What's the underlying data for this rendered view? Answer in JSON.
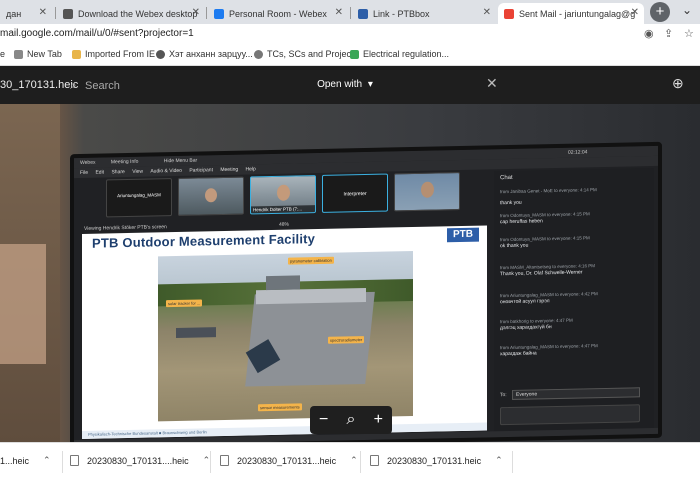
{
  "browser": {
    "tabs": [
      {
        "label": "дан",
        "color": "#888"
      },
      {
        "label": "Download the Webex desktop",
        "color": "#555"
      },
      {
        "label": "Personal Room - Webex",
        "color": "#1d7bf0"
      },
      {
        "label": "Link - PTBbox",
        "color": "#2d5ea8"
      },
      {
        "label": "Sent Mail - jariuntungalag@g",
        "color": "#ea4335"
      }
    ],
    "add_tab": "+",
    "url": "mail.google.com/mail/u/0/#sent?projector=1",
    "bookmarks": [
      "e",
      "New Tab",
      "Imported From IE",
      "Хэт анханн зарцуу...",
      "TCs, SCs and Projec...",
      "Electrical regulation..."
    ]
  },
  "viewer": {
    "file_name": "30_170131.heic",
    "search_placeholder": "Search",
    "open_with": "Open with"
  },
  "webex": {
    "title_items": [
      "Webex",
      "Meeting Info",
      "Hide Menu Bar"
    ],
    "time": "02:12:04",
    "menu": [
      "File",
      "Edit",
      "Share",
      "View",
      "Audio & Video",
      "Participant",
      "Meeting",
      "Help"
    ],
    "participants": [
      "Ariuntungalag_MASM",
      "",
      "Hendrik Dolter PTB (7:...",
      "Interpreter",
      ""
    ],
    "viewing_label": "Viewing Hendrik Stöker PTB's screen",
    "zoom": "48%",
    "slide": {
      "title": "PTB Outdoor Measurement Facility",
      "logo": "PTB",
      "callouts": [
        "pyranometer calibration",
        "solar tracker for ...",
        "sensor measurements",
        "spectroradiometer"
      ],
      "footer": "Physikalisch-Technische Bundesanstalt  ■  Braunschweig und Berlin"
    },
    "chat": {
      "header": "Chat",
      "messages": [
        {
          "from": "",
          "text": "thank you"
        },
        {
          "from": "from Janibaa Genet - MoE to everyone:  4:14 PM",
          "text": ""
        },
        {
          "from": "from Odontuya_MASM to everyone:  4:15 PM",
          "text": "сар heruffas heben"
        },
        {
          "from": "from Odontuya_MASM to everyone:  4:15 PM",
          "text": "ok thank you"
        },
        {
          "from": "from MASM_Altantsetseg to everyone:  4:16 PM",
          "text": "Thank you, Dr. Olaf Schwelle-Werner"
        },
        {
          "from": "from Ariuntungalag_MASM to everyone:  4:42 PM",
          "text": "оновчтой асуул гэрэл"
        },
        {
          "from": "from batkhorig to everyone:  4:47 PM",
          "text": "дэлгэц харагдахгүй бн"
        },
        {
          "from": "from Ariuntungalag_MASM to everyone:  4:47 PM",
          "text": "харагдаж байна"
        }
      ],
      "to_label": "To:",
      "to_value": "Everyone"
    }
  },
  "zoom_tools": [
    "−",
    "⌕",
    "+"
  ],
  "downloads": [
    {
      "name": "1...heic"
    },
    {
      "name": "20230830_170131....heic"
    },
    {
      "name": "20230830_170131...heic"
    },
    {
      "name": "20230830_170131.heic"
    }
  ]
}
